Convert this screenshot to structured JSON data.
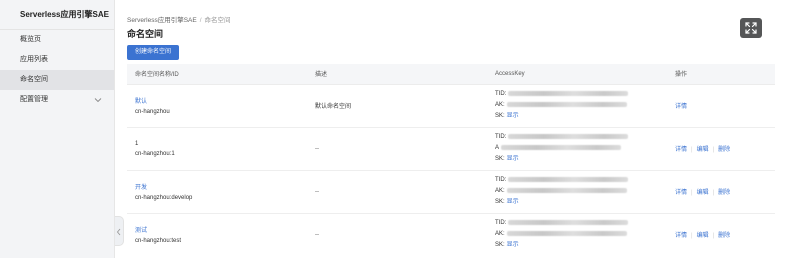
{
  "sidebar": {
    "brand": "Serverless应用引擎SAE",
    "items": [
      {
        "label": "概览页"
      },
      {
        "label": "应用列表"
      },
      {
        "label": "命名空间"
      },
      {
        "label": "配置管理"
      }
    ]
  },
  "breadcrumb": {
    "root": "Serverless应用引擎SAE",
    "separator": "/",
    "current": "命名空间"
  },
  "page_title": "命名空间",
  "create_button": "创建命名空间",
  "table": {
    "headers": [
      "命名空间名称/ID",
      "描述",
      "AccessKey",
      "操作"
    ],
    "ak_labels": {
      "tid": "TID:",
      "ak": "AK:",
      "sk": "SK:",
      "sk_action": "显示"
    },
    "ops": {
      "detail": "详情",
      "edit": "编辑",
      "delete": "删除",
      "sep": "|"
    },
    "rows": [
      {
        "name": "默认",
        "id": "cn-hangzhou",
        "desc": "默认命名空间",
        "ak_prefix": "AK:"
      },
      {
        "name": "1",
        "id": "cn-hangzhou:1",
        "desc": "--",
        "ak_prefix": "A"
      },
      {
        "name": "开发",
        "id": "cn-hangzhou:develop",
        "desc": "--",
        "ak_prefix": "AK:"
      },
      {
        "name": "测试",
        "id": "cn-hangzhou:test",
        "desc": "--",
        "ak_prefix": "AK:"
      }
    ]
  },
  "colors": {
    "primary": "#3b73d1",
    "sidebar_bg": "#f3f4f6",
    "active_bg": "#e2e3e6"
  },
  "icons": [
    "fullscreen-icon",
    "chevron-down-icon",
    "chevron-left-icon"
  ]
}
